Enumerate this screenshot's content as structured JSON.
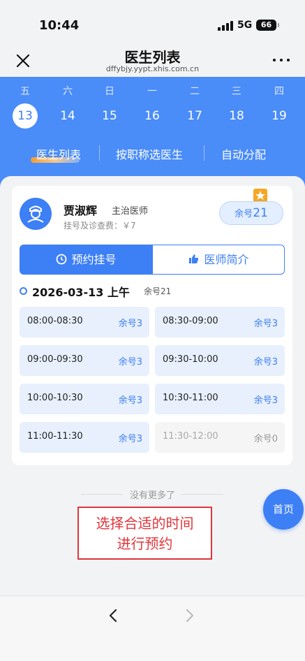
{
  "status_bar": {
    "time": "10:44",
    "network": "5G",
    "battery": "66"
  },
  "nav": {
    "title": "医生列表",
    "url": "dffybjy.yypt.xhis.com.cn"
  },
  "calendar": {
    "weekdays": [
      "五",
      "六",
      "日",
      "一",
      "二",
      "三",
      "四"
    ],
    "dates": [
      "13",
      "14",
      "15",
      "16",
      "17",
      "18",
      "19"
    ],
    "selected_index": 0
  },
  "tabs": [
    "医生列表",
    "按职称选医生",
    "自动分配"
  ],
  "doctor": {
    "name": "贾淑辉",
    "title": "主治医师",
    "fee": "挂号及诊查费：￥7",
    "remain_label": "余号",
    "remain_count": "21"
  },
  "buttons": {
    "book": "预约挂号",
    "intro": "医师简介"
  },
  "session": {
    "date": "2026-03-13 上午",
    "remain": "余号21"
  },
  "slots": [
    {
      "time": "08:00-08:30",
      "remain": "余号3",
      "available": true
    },
    {
      "time": "08:30-09:00",
      "remain": "余号3",
      "available": true
    },
    {
      "time": "09:00-09:30",
      "remain": "余号3",
      "available": true
    },
    {
      "time": "09:30-10:00",
      "remain": "余号3",
      "available": true
    },
    {
      "time": "10:00-10:30",
      "remain": "余号3",
      "available": true
    },
    {
      "time": "10:30-11:00",
      "remain": "余号3",
      "available": true
    },
    {
      "time": "11:00-11:30",
      "remain": "余号3",
      "available": true
    },
    {
      "time": "11:30-12:00",
      "remain": "余号0",
      "available": false
    }
  ],
  "footer": {
    "no_more": "没有更多了",
    "home": "首页"
  },
  "annotation": {
    "line1": "选择合适的时间",
    "line2": "进行预约"
  },
  "colors": {
    "primary": "#3d7ff5",
    "header_blue": "#4a8cf8",
    "annotation_red": "#e0363b",
    "star": "#f5a623"
  }
}
